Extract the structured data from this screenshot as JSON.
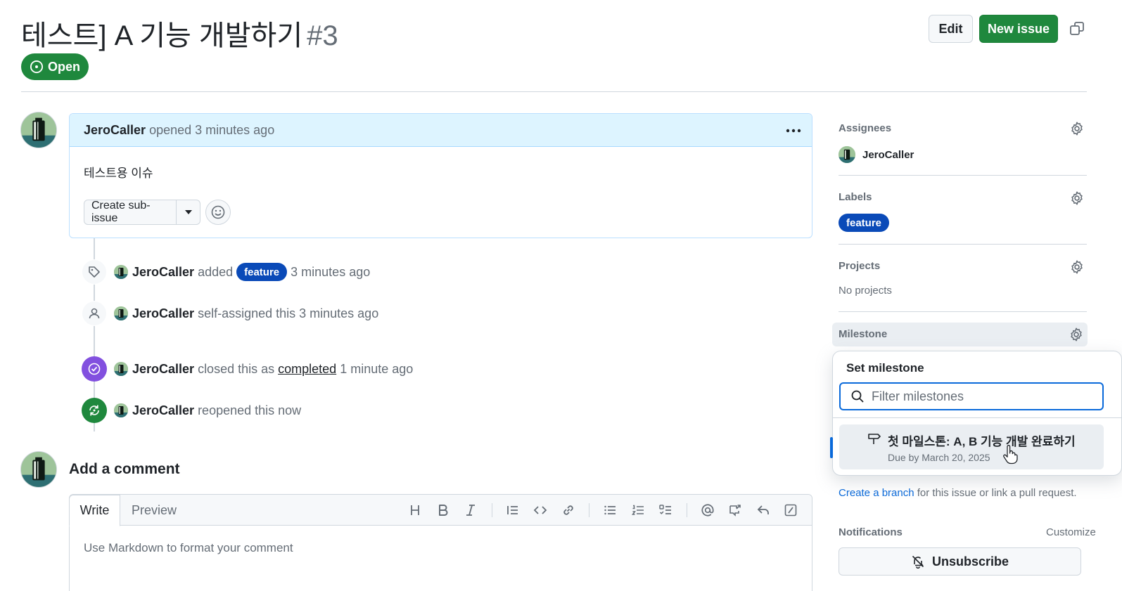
{
  "issue": {
    "title": "테스트] A 기능 개발하기",
    "number": "#3",
    "state": "Open"
  },
  "header_actions": {
    "edit": "Edit",
    "new_issue": "New issue"
  },
  "body": {
    "author": "JeroCaller",
    "meta": "opened 3 minutes ago",
    "text": "테스트용 이슈",
    "create_sub_issue": "Create sub-issue"
  },
  "timeline": [
    {
      "user": "JeroCaller",
      "before": "added",
      "label": "feature",
      "after": "3 minutes ago"
    },
    {
      "user": "JeroCaller",
      "text": "self-assigned this 3 minutes ago"
    },
    {
      "user": "JeroCaller",
      "before": "closed this as",
      "link": "completed",
      "after": "1 minute ago"
    },
    {
      "user": "JeroCaller",
      "text": "reopened this now"
    }
  ],
  "comment": {
    "heading": "Add a comment",
    "tab_write": "Write",
    "tab_preview": "Preview",
    "placeholder": "Use Markdown to format your comment"
  },
  "sidebar": {
    "assignees": {
      "heading": "Assignees",
      "user": "JeroCaller"
    },
    "labels": {
      "heading": "Labels",
      "label": "feature"
    },
    "projects": {
      "heading": "Projects",
      "empty": "No projects"
    },
    "milestone": {
      "heading": "Milestone"
    },
    "development": {
      "link": "Create a branch",
      "text": "for this issue or link a pull request."
    },
    "notifications": {
      "heading": "Notifications",
      "customize": "Customize",
      "unsubscribe": "Unsubscribe"
    }
  },
  "milestone_popover": {
    "title": "Set milestone",
    "filter_placeholder": "Filter milestones",
    "items": [
      {
        "name": "첫 마일스톤: A, B 기능 개발 완료하기",
        "due": "Due by March 20, 2025"
      }
    ]
  },
  "colors": {
    "open_green": "#1f883d",
    "label_feature": "#0a4ab8",
    "closed_purple": "#8250df",
    "accent_blue": "#0969da"
  }
}
